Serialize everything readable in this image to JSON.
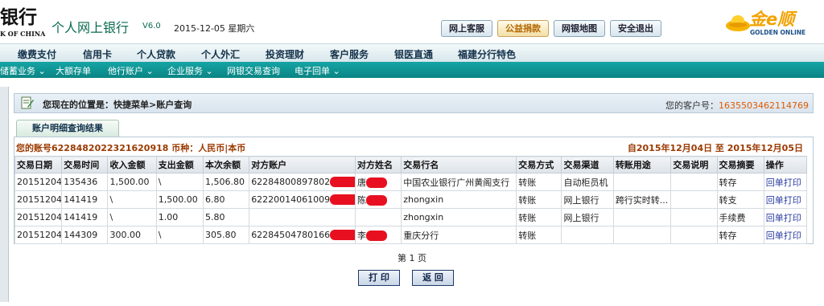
{
  "header": {
    "bank_name": "银行",
    "bank_name_en": "K OF CHINA",
    "system_title": "个人网上银行",
    "version": "V6.0",
    "date": "2015-12-05 星期六",
    "buttons": [
      "网上客服",
      "公益捐款",
      "网银地图",
      "安全退出"
    ],
    "logo_text": "金e顺",
    "logo_sub": "GOLDEN ONLINE"
  },
  "nav_main": [
    "缴费支付",
    "信用卡",
    "个人贷款",
    "个人外汇",
    "投资理财",
    "客户服务",
    "银医直通",
    "福建分行特色"
  ],
  "nav_sub": [
    "储蓄业务 ⌄",
    "大额存单",
    "他行账户 ⌄",
    "企业服务 ⌄",
    "网银交易查询",
    "电子回单 ⌄"
  ],
  "location": {
    "text": "您现在的位置是：快捷菜单>账户查询",
    "customer_label": "您的客户号：",
    "customer_no": "1635503462114769"
  },
  "tab_title": "账户明细查询结果",
  "summary": {
    "account": "您的账号6228482022321620918 币种：人民币|本币",
    "period": "自2015年12月04日  至  2015年12月05日"
  },
  "columns": [
    "交易日期",
    "交易时间",
    "收入金额",
    "支出金额",
    "本次余额",
    "对方账户",
    "对方姓名",
    "交易行名",
    "交易方式",
    "交易渠道",
    "转账用途",
    "交易说明",
    "交易摘要",
    "操作"
  ],
  "rows": [
    {
      "date": "20151204",
      "time": "135436",
      "income": "1,500.00",
      "expense": "\\",
      "balance": "1,506.80",
      "account": "62284800897802",
      "name": "唐",
      "bank": "中国农业银行广州黄阁支行",
      "method": "转账",
      "channel": "自动柜员机",
      "purpose": "",
      "note": "",
      "summary": "转存",
      "action": "回单打印"
    },
    {
      "date": "20151204",
      "time": "141419",
      "income": "\\",
      "expense": "1,500.00",
      "balance": "6.80",
      "account": "62220014061009",
      "name": "陈",
      "bank": "zhongxin",
      "method": "转账",
      "channel": "网上银行",
      "purpose": "跨行实时转...",
      "note": "",
      "summary": "转支",
      "action": "回单打印"
    },
    {
      "date": "20151204",
      "time": "141419",
      "income": "\\",
      "expense": "1.00",
      "balance": "5.80",
      "account": "",
      "name": "",
      "bank": "zhongxin",
      "method": "转账",
      "channel": "网上银行",
      "purpose": "",
      "note": "",
      "summary": "手续费",
      "action": "回单打印"
    },
    {
      "date": "20151204",
      "time": "144309",
      "income": "300.00",
      "expense": "\\",
      "balance": "305.80",
      "account": "62284504780166",
      "name": "李",
      "bank": "重庆分行",
      "method": "转账",
      "channel": "",
      "purpose": "",
      "note": "",
      "summary": "转存",
      "action": "回单打印"
    }
  ],
  "pagination": "第 1 页",
  "buttons_bottom": {
    "print": "打 印",
    "back": "返 回"
  },
  "colors": {
    "teal": "#0a8484",
    "accent_orange": "#e05a00",
    "redaction": "#e81020"
  }
}
